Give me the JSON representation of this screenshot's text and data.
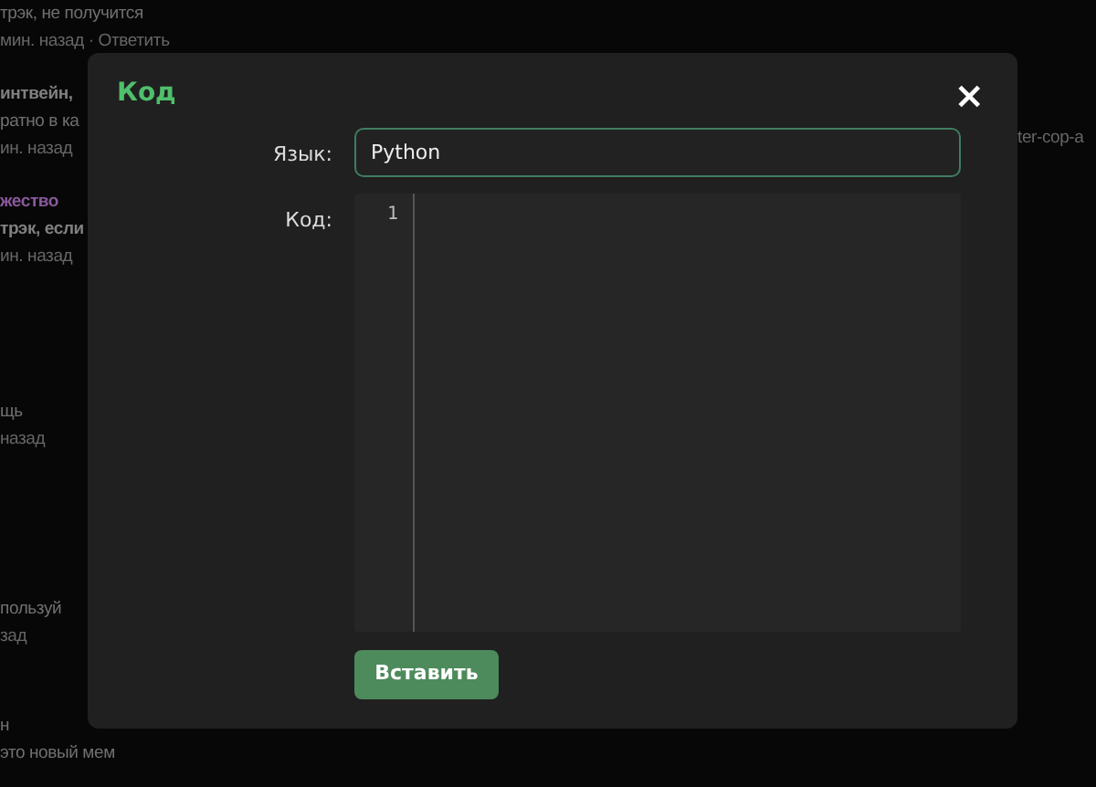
{
  "background": {
    "groups": [
      {
        "lines": [
          {
            "kind": "text",
            "text": "трэк, не получится"
          },
          {
            "kind": "meta",
            "text": "мин. назад · Ответить"
          }
        ]
      },
      {
        "lines": [
          {
            "kind": "strong",
            "text": "интвейн,"
          },
          {
            "kind": "text",
            "text": "ратно в ка"
          },
          {
            "kind": "meta",
            "text": "ин. назад"
          }
        ]
      },
      {
        "lines": [
          {
            "kind": "tag",
            "text": "жество"
          },
          {
            "kind": "strong",
            "text": "трэк, если"
          },
          {
            "kind": "meta",
            "text": "ин. назад"
          }
        ]
      },
      {
        "lines": [
          {
            "kind": "text",
            "text": "щь"
          },
          {
            "kind": "meta",
            "text": "назад"
          }
        ]
      },
      {
        "lines": [
          {
            "kind": "text",
            "text": "пользуй"
          },
          {
            "kind": "meta",
            "text": "зад"
          }
        ]
      },
      {
        "lines": [
          {
            "kind": "text",
            "text": "н"
          },
          {
            "kind": "text",
            "text": "это новый мем"
          }
        ]
      }
    ],
    "side_text": "ter-cop-a"
  },
  "dialog": {
    "title": "Код",
    "close": "×",
    "language": {
      "label": "Язык:",
      "value": "Python"
    },
    "code": {
      "label": "Код:",
      "line_numbers": [
        "1"
      ]
    },
    "submit": "Вставить"
  }
}
